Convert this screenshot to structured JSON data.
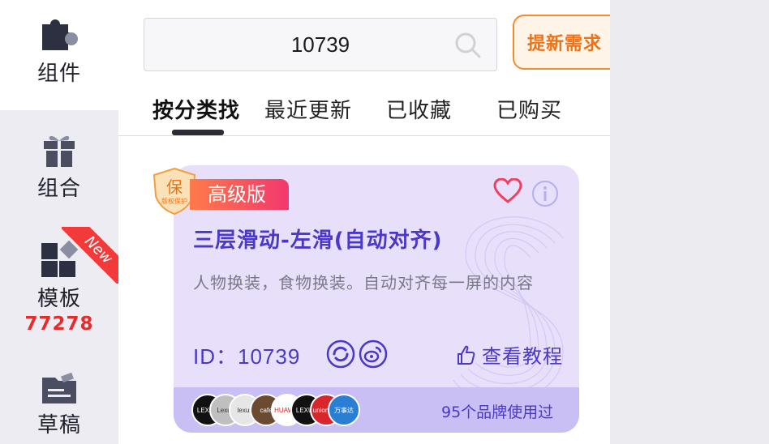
{
  "sidebar": {
    "items": [
      {
        "label": "组件",
        "icon": "puzzle-icon"
      },
      {
        "label": "组合",
        "icon": "gift-icon"
      },
      {
        "label": "模板",
        "icon": "template-icon",
        "count": "77278",
        "ribbon": "New"
      },
      {
        "label": "草稿",
        "icon": "draft-icon"
      }
    ]
  },
  "search": {
    "value": "10739",
    "icon": "search-icon"
  },
  "request_button": {
    "label": "提新需求"
  },
  "tabs": [
    {
      "label": "按分类找",
      "active": true
    },
    {
      "label": "最近更新"
    },
    {
      "label": "已收藏"
    },
    {
      "label": "已购买"
    }
  ],
  "card": {
    "badge": "高级版",
    "shield_text": "保",
    "shield_subtext": "版权保护",
    "title": "三层滑动-左滑(自动对齐)",
    "description": "人物换装，食物换装。自动对齐每一屏的内容",
    "id_label": "ID：",
    "id_value": "10739",
    "tutorial_label": "查看教程",
    "brands_used": "95个品牌使用过",
    "brand_logos": [
      "LEXUS",
      "Lexus",
      "lexus",
      "cafe",
      "HUAWEI",
      "LEXUS",
      "unionpay",
      "万事达"
    ],
    "accent_color": "#4a38c8"
  }
}
